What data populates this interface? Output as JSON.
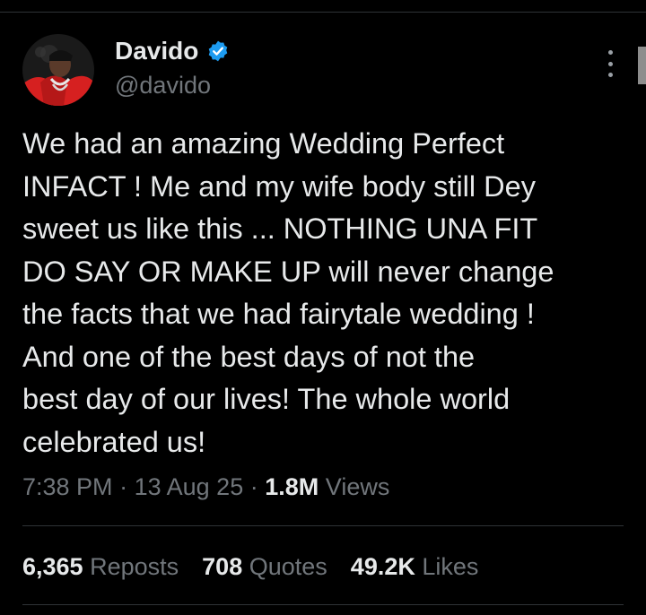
{
  "author": {
    "display_name": "Davido",
    "handle": "@davido",
    "verified": true,
    "avatar_icon": "profile-photo-avatar"
  },
  "tweet": {
    "text": "We had an amazing Wedding Perfect\nINFACT ! Me and my wife body still Dey\nsweet us like  this ... NOTHING UNA FIT\nDO SAY OR MAKE UP will never change\nthe facts that we had fairytale wedding !\nAnd one of the best days of not the\nbest day of our lives! The whole world\ncelebrated us!",
    "time": "7:38 PM",
    "separator": "·",
    "date": "13 Aug 25",
    "views_count": "1.8M",
    "views_label": "Views"
  },
  "stats": {
    "reposts_count": "6,365",
    "reposts_label": "Reposts",
    "quotes_count": "708",
    "quotes_label": "Quotes",
    "likes_count": "49.2K",
    "likes_label": "Likes"
  },
  "icons": {
    "verified": "verified-badge-icon",
    "more": "more-options-icon"
  },
  "colors": {
    "background": "#000000",
    "primary_text": "#e7e9ea",
    "secondary_text": "#71767b",
    "verified_blue": "#1d9bf0",
    "divider": "#2f3336"
  }
}
